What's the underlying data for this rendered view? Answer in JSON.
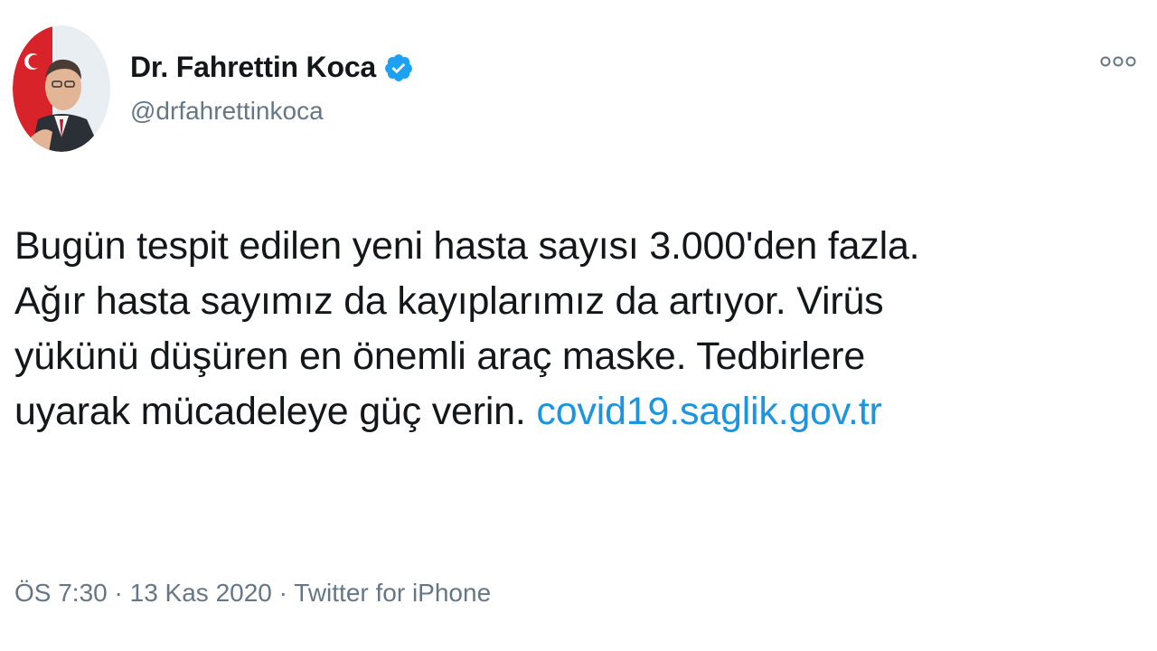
{
  "tweet": {
    "author": {
      "display_name": "Dr. Fahrettin Koca",
      "handle": "@drfahrettinkoca",
      "verified": true,
      "avatar": "profile-photo"
    },
    "more_menu_icon": "more-options-icon",
    "text": {
      "line1": "Bugün tespit edilen yeni hasta sayısı 3.000'den fazla.",
      "line2": "Ağır hasta sayımız da kayıplarımız da artıyor. Virüs",
      "line3": "yükünü düşüren en önemli araç maske. Tedbirlere",
      "line4_text": "uyarak mücadeleye güç verin.",
      "link": "covid19.saglik.gov.tr"
    },
    "meta": {
      "time": "ÖS 7:30",
      "separator1": "·",
      "date": "13 Kas 2020",
      "separator2": "·",
      "source": "Twitter for iPhone"
    }
  },
  "colors": {
    "text": "#14171a",
    "secondary": "#657786",
    "link": "#1b95e0",
    "verified": "#1da1f2"
  }
}
